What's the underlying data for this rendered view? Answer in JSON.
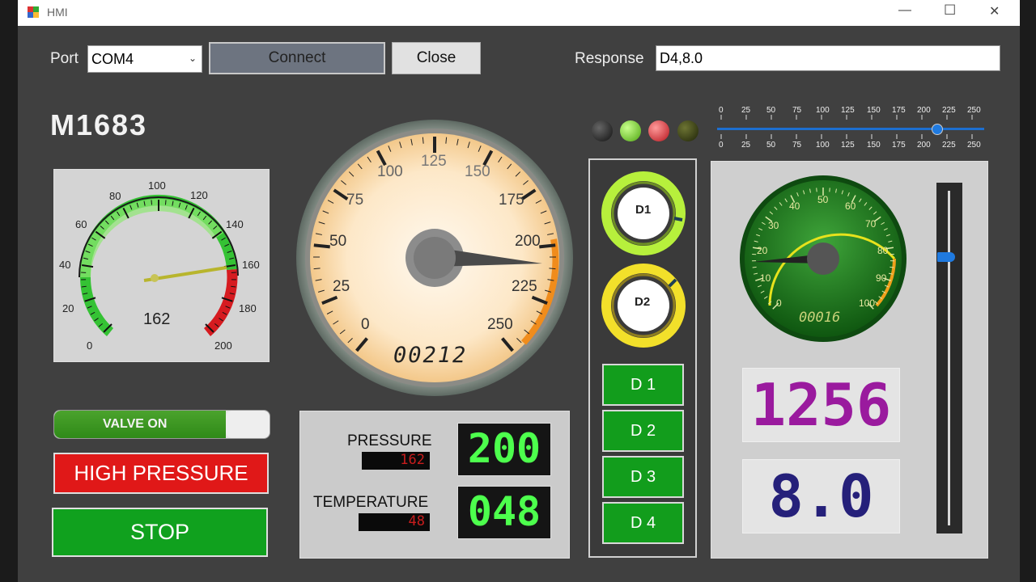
{
  "window": {
    "title": "HMI"
  },
  "connection": {
    "port_label": "Port",
    "port_value": "COM4",
    "connect_label": "Connect",
    "close_label": "Close",
    "response_label": "Response",
    "response_value": "D4,8.0"
  },
  "device_title": "M1683",
  "left_gauge": {
    "value": "162",
    "ticks": [
      "0",
      "20",
      "40",
      "60",
      "80",
      "100",
      "120",
      "140",
      "160",
      "180",
      "200"
    ]
  },
  "big_gauge": {
    "odometer": "00212",
    "ticks": [
      "0",
      "25",
      "50",
      "75",
      "100",
      "125",
      "150",
      "175",
      "200",
      "225",
      "250"
    ]
  },
  "green_gauge": {
    "odometer": "00016",
    "ticks": [
      "0",
      "10",
      "20",
      "30",
      "40",
      "50",
      "60",
      "70",
      "80",
      "90",
      "100"
    ]
  },
  "valve_label": "VALVE ON",
  "alarm_label": "HIGH PRESSURE",
  "stop_label": "STOP",
  "pressure": {
    "label": "PRESSURE",
    "value": "162",
    "segment": "200"
  },
  "temperature": {
    "label": "TEMPERATURE",
    "value": "48",
    "segment": "048"
  },
  "dials": [
    {
      "label": "D1"
    },
    {
      "label": "D2"
    }
  ],
  "d_buttons": [
    "D 1",
    "D 2",
    "D 3",
    "D 4"
  ],
  "slider_ticks": [
    "0",
    "25",
    "50",
    "75",
    "100",
    "125",
    "150",
    "175",
    "200",
    "225",
    "250"
  ],
  "segment_display_1": "1256",
  "segment_display_2": "8.0",
  "leds": [
    {
      "color": "#111111"
    },
    {
      "color": "#6fcf1d"
    },
    {
      "color": "#d0202a"
    },
    {
      "color": "#2e3410"
    }
  ],
  "window_buttons": {
    "minimize": "—",
    "maximize": "☐",
    "close": "✕"
  }
}
